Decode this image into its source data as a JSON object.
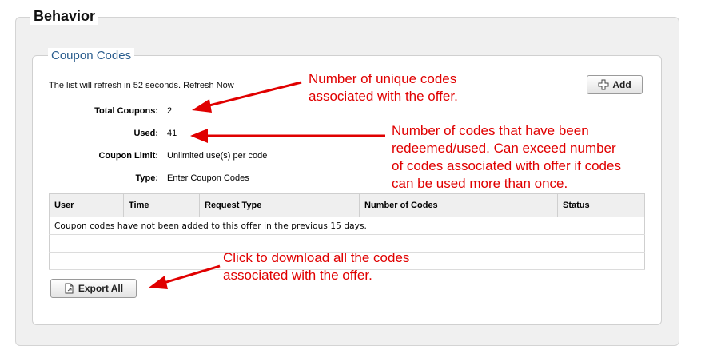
{
  "section": {
    "title": "Behavior"
  },
  "coupon": {
    "title": "Coupon Codes",
    "refresh_text": "The list will refresh in 52 seconds.",
    "refresh_link": "Refresh Now",
    "add_label": "Add",
    "rows": [
      {
        "label": "Total Coupons:",
        "value": "2"
      },
      {
        "label": "Used:",
        "value": "41"
      },
      {
        "label": "Coupon Limit:",
        "value": "Unlimited use(s) per code"
      },
      {
        "label": "Type:",
        "value": "Enter Coupon Codes"
      }
    ],
    "table": {
      "columns": [
        "User",
        "Time",
        "Request Type",
        "Number of Codes",
        "Status"
      ],
      "empty_message": "Coupon codes have not been added to this offer in the previous 15 days."
    },
    "export_label": "Export All"
  },
  "annotations": {
    "unique_codes": [
      "Number of unique codes",
      "associated with the offer."
    ],
    "redeemed": [
      "Number of codes that have been",
      "redeemed/used. Can exceed number",
      "of codes associated with offer if codes",
      "can be used more than once."
    ],
    "download": [
      "Click to download all the codes",
      "associated with the offer."
    ]
  },
  "colors": {
    "annotation": "#e00000",
    "legend": "#2a5d8e"
  },
  "icons": {
    "add": "plus-icon",
    "export": "export-document-icon"
  }
}
